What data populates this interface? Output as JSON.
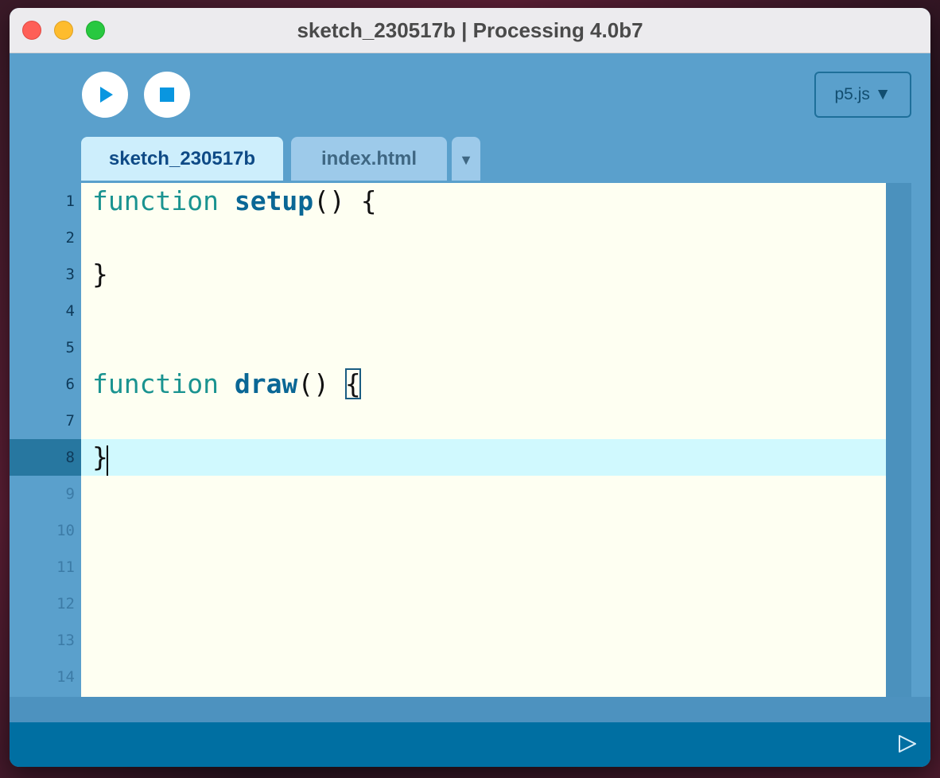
{
  "window": {
    "title": "sketch_230517b | Processing 4.0b7"
  },
  "toolbar": {
    "run_icon": "play-icon",
    "stop_icon": "stop-icon",
    "mode_label": "p5.js ▼"
  },
  "tabs": [
    {
      "label": "sketch_230517b",
      "active": true
    },
    {
      "label": "index.html",
      "active": false
    }
  ],
  "tab_menu_label": "▼",
  "editor": {
    "line_numbers": [
      "1",
      "2",
      "3",
      "4",
      "5",
      "6",
      "7",
      "8",
      "9",
      "10",
      "11",
      "12",
      "13",
      "14"
    ],
    "current_line": 8,
    "code": {
      "l1": {
        "kw": "function",
        "name": "setup",
        "rest": "() {"
      },
      "l3": "}",
      "l6": {
        "kw": "function",
        "name": "draw",
        "paren": "() ",
        "brace": "{"
      },
      "l8": "}"
    }
  },
  "status_bar": {
    "console_icon": "triangle-right-icon"
  },
  "colors": {
    "window_bg": "#5aa0cc",
    "editor_bg": "#fefff2",
    "current_line_bg": "#d0f9fe",
    "keyword": "#1a9390",
    "function_name": "#0a6795",
    "status_bar": "#006fa2"
  }
}
